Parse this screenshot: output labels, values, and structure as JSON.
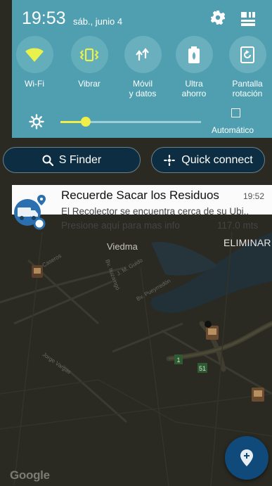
{
  "status": {
    "time": "19:53",
    "date": "sáb., junio 4"
  },
  "quick_toggles": [
    {
      "label": "Wi-Fi",
      "icon": "wifi-icon",
      "active": true
    },
    {
      "label": "Vibrar",
      "icon": "vibrate-icon",
      "active": true
    },
    {
      "label": "Móvil\ny datos",
      "icon": "mobile-data-icon",
      "active": false
    },
    {
      "label": "Ultra\nahorro",
      "icon": "battery-saver-icon",
      "active": false
    },
    {
      "label": "Pantalla\nrotación",
      "icon": "screen-rotation-icon",
      "active": false
    }
  ],
  "brightness": {
    "level": 0.18,
    "auto_label": "Automático"
  },
  "finder": {
    "sfinder_label": "S Finder",
    "quick_connect_label": "Quick connect"
  },
  "notification": {
    "title": "Recuerde Sacar los Residuos",
    "time": "19:52",
    "body": "El Recolector se encuentra cerca de su Ubi..",
    "sub": "Presione aquí para mas info",
    "distance": "117.0 mts"
  },
  "map": {
    "city_label": "Viedma",
    "action_label": "ELIMINAR",
    "logo_text": "Google"
  },
  "colors": {
    "panel": "#4f9fb0",
    "toggle_active": "#64aebc",
    "accent_yellow": "#f1ee4a",
    "pill_bg": "#0d2e42",
    "fab": "#0f4a7a"
  }
}
